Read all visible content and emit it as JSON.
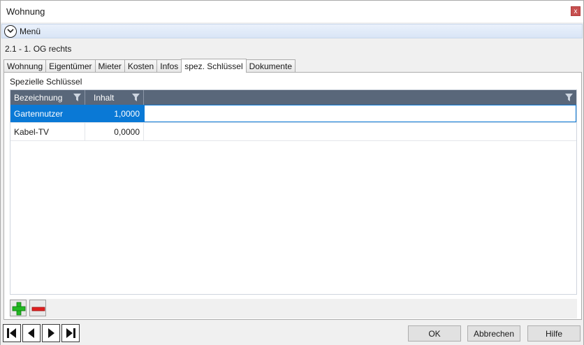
{
  "window": {
    "title": "Wohnung",
    "close_label": "x"
  },
  "menu": {
    "label": "Menü",
    "toggle_icon": "chevron-down-circle-icon"
  },
  "record_title": "2.1 - 1. OG rechts",
  "tabs": [
    {
      "label": "Wohnung",
      "active": false
    },
    {
      "label": "Eigentümer",
      "active": false
    },
    {
      "label": "Mieter",
      "active": false
    },
    {
      "label": "Kosten",
      "active": false
    },
    {
      "label": "Infos",
      "active": false
    },
    {
      "label": "spez. Schlüssel",
      "active": true
    },
    {
      "label": "Dokumente",
      "active": false
    }
  ],
  "panel": {
    "group_label": "Spezielle Schlüssel",
    "grid": {
      "columns": [
        {
          "label": "Bezeichnung",
          "filter_icon": "filter-icon"
        },
        {
          "label": "Inhalt",
          "filter_icon": "filter-icon"
        },
        {
          "label": "",
          "filter_icon": "filter-icon"
        }
      ],
      "rows": [
        {
          "bezeichnung": "Gartennutzer",
          "inhalt": "1,0000",
          "selected": true
        },
        {
          "bezeichnung": "Kabel-TV",
          "inhalt": "0,0000",
          "selected": false
        }
      ]
    },
    "tools": {
      "add_icon": "plus-icon",
      "remove_icon": "minus-icon"
    }
  },
  "navigation": {
    "first_icon": "first-record-icon",
    "prev_icon": "previous-record-icon",
    "next_icon": "next-record-icon",
    "last_icon": "last-record-icon"
  },
  "buttons": {
    "ok": "OK",
    "cancel": "Abbrechen",
    "help": "Hilfe"
  },
  "colors": {
    "grid_header": "#59677a",
    "selection": "#0a79d6",
    "menubar": "#dce7f7",
    "add": "#22b822",
    "remove": "#e02020"
  }
}
